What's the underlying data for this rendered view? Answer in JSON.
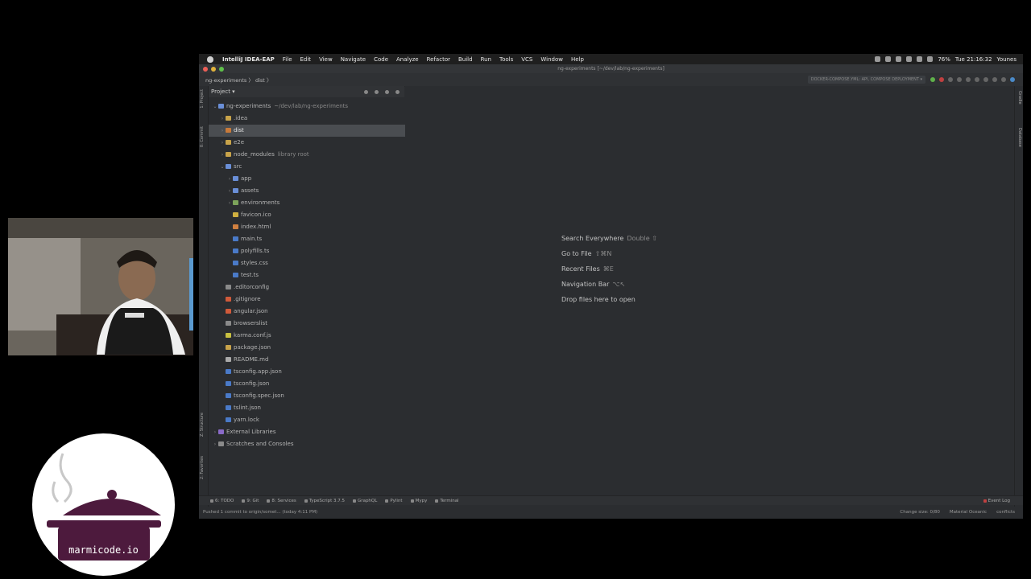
{
  "menubar": {
    "items": [
      "IntelliJ IDEA-EAP",
      "File",
      "Edit",
      "View",
      "Navigate",
      "Code",
      "Analyze",
      "Refactor",
      "Build",
      "Run",
      "Tools",
      "VCS",
      "Window",
      "Help"
    ],
    "battery": "76%",
    "clock": "Tue 21:16:32",
    "user": "Younes"
  },
  "titlebar": {
    "title": "ng-experiments [~/dev/lab/ng-experiments]"
  },
  "navbar": {
    "breadcrumb": "ng-experiments 〉 dist 〉",
    "run_config": "DOCKER-COMPOSE.YML: API, COMPOSE DEPLOYMENT ▾"
  },
  "sidebar_tabs": {
    "project": "1: Project",
    "commit": "0: Commit",
    "structure": "Z: Structure",
    "favorites": "2: Favorites"
  },
  "right_tabs": {
    "gradle": "Gradle",
    "database": "Database"
  },
  "project_panel": {
    "header": "Project ▾",
    "tree": [
      {
        "label": "ng-experiments",
        "hint": "~/dev/lab/ng-experiments",
        "arrow": "⌄",
        "color": "#6a8fd8"
      },
      {
        "label": ".idea",
        "hint": "",
        "arrow": "›",
        "color": "#c8a34a"
      },
      {
        "label": "dist",
        "hint": "",
        "arrow": "›",
        "color": "#c87a3a"
      },
      {
        "label": "e2e",
        "hint": "",
        "arrow": "›",
        "color": "#c8a34a"
      },
      {
        "label": "node_modules",
        "hint": "library root",
        "arrow": "›",
        "color": "#c8a34a"
      },
      {
        "label": "src",
        "hint": "",
        "arrow": "⌄",
        "color": "#6a8fd8"
      },
      {
        "label": "app",
        "hint": "",
        "arrow": "›",
        "color": "#6a8fd8"
      },
      {
        "label": "assets",
        "hint": "",
        "arrow": "›",
        "color": "#6a8fd8"
      },
      {
        "label": "environments",
        "hint": "",
        "arrow": "›",
        "color": "#7ca35a"
      },
      {
        "label": "favicon.ico",
        "hint": "",
        "arrow": "",
        "color": "#d0b040"
      },
      {
        "label": "index.html",
        "hint": "",
        "arrow": "",
        "color": "#d08040"
      },
      {
        "label": "main.ts",
        "hint": "",
        "arrow": "",
        "color": "#4a7ac8"
      },
      {
        "label": "polyfills.ts",
        "hint": "",
        "arrow": "",
        "color": "#4a7ac8"
      },
      {
        "label": "styles.css",
        "hint": "",
        "arrow": "",
        "color": "#4a7ac8"
      },
      {
        "label": "test.ts",
        "hint": "",
        "arrow": "",
        "color": "#4a7ac8"
      },
      {
        "label": ".editorconfig",
        "hint": "",
        "arrow": "",
        "color": "#8a8a8a"
      },
      {
        "label": ".gitignore",
        "hint": "",
        "arrow": "",
        "color": "#d05a3a"
      },
      {
        "label": "angular.json",
        "hint": "",
        "arrow": "",
        "color": "#d05a3a"
      },
      {
        "label": "browserslist",
        "hint": "",
        "arrow": "",
        "color": "#8a8a8a"
      },
      {
        "label": "karma.conf.js",
        "hint": "",
        "arrow": "",
        "color": "#c8c040"
      },
      {
        "label": "package.json",
        "hint": "",
        "arrow": "",
        "color": "#c8a34a"
      },
      {
        "label": "README.md",
        "hint": "",
        "arrow": "",
        "color": "#aaaaaa"
      },
      {
        "label": "tsconfig.app.json",
        "hint": "",
        "arrow": "",
        "color": "#4a7ac8"
      },
      {
        "label": "tsconfig.json",
        "hint": "",
        "arrow": "",
        "color": "#4a7ac8"
      },
      {
        "label": "tsconfig.spec.json",
        "hint": "",
        "arrow": "",
        "color": "#4a7ac8"
      },
      {
        "label": "tslint.json",
        "hint": "",
        "arrow": "",
        "color": "#4a7ac8"
      },
      {
        "label": "yarn.lock",
        "hint": "",
        "arrow": "",
        "color": "#4a7ac8"
      },
      {
        "label": "External Libraries",
        "hint": "",
        "arrow": "›",
        "color": "#8a6ac8"
      },
      {
        "label": "Scratches and Consoles",
        "hint": "",
        "arrow": "›",
        "color": "#8a8a8a"
      }
    ]
  },
  "editor_hints": [
    {
      "label": "Search Everywhere",
      "key": "Double ⇧"
    },
    {
      "label": "Go to File",
      "key": "⇧⌘N"
    },
    {
      "label": "Recent Files",
      "key": "⌘E"
    },
    {
      "label": "Navigation Bar",
      "key": "⌥↖"
    },
    {
      "label": "Drop files here to open",
      "key": ""
    }
  ],
  "bottom_tools": [
    "6: TODO",
    "9: Git",
    "8: Services",
    "TypeScript 3.7.5",
    "GraphQL",
    "Pylint",
    "Mypy",
    "Terminal"
  ],
  "event_log": "Event Log",
  "status": {
    "message": "Pushed 1 commit to origin/somet... (today 4:11 PM)",
    "change_size": "Change size: 0/80",
    "theme": "Material Oceanic",
    "branch": "conflicts"
  },
  "logo": {
    "text": "marmicode.io"
  }
}
